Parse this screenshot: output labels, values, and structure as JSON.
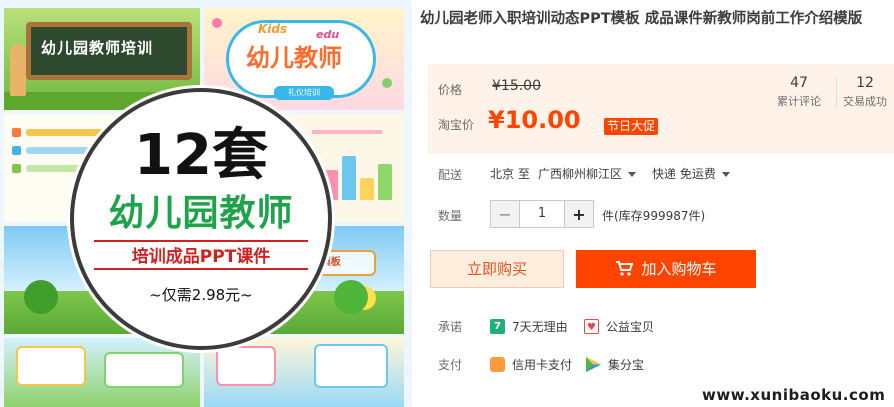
{
  "product_image": {
    "count": "12套",
    "main_text": "幼儿园教师",
    "sub_text": "培训成品PPT课件",
    "price_text": "~仅需2.98元~",
    "tile1_title": "幼儿园教师培训",
    "tile2_kids": "Kids",
    "tile2_edu": "edu",
    "tile2_big": "幼儿教师",
    "tile2_ribbon": "礼仪培训",
    "tile5_banner": "培训PPT模板"
  },
  "product": {
    "title": "幼儿园老师入职培训动态PPT模板 成品课件新教师岗前工作介绍模版"
  },
  "price_panel": {
    "price_label": "价格",
    "original_price": "¥15.00",
    "taobao_label": "淘宝价",
    "current_price": "¥10.00",
    "festival_badge": "节日大促",
    "reviews_count": "47",
    "reviews_label": "累计评论",
    "sales_count": "12",
    "sales_label": "交易成功"
  },
  "shipping": {
    "label": "配送",
    "from": "北京 至",
    "to": "广西柳州柳江区",
    "method": "快递 免运费"
  },
  "quantity": {
    "label": "数量",
    "value": "1",
    "minus": "−",
    "plus": "+",
    "stock": "件(库存999987件)"
  },
  "actions": {
    "buy_now": "立即购买",
    "add_to_cart": "加入购物车"
  },
  "promise": {
    "label": "承诺",
    "items": [
      "7天无理由",
      "公益宝贝"
    ]
  },
  "payment": {
    "label": "支付",
    "items": [
      "信用卡支付",
      "集分宝"
    ]
  },
  "watermark": "www.xunibaoku.com",
  "colors": {
    "accent": "#ff4400",
    "price_panel_bg": "#fff2e8",
    "green_badge": "#22b07a",
    "red_badge": "#e84747",
    "orange_badge": "#ff9a3a"
  }
}
